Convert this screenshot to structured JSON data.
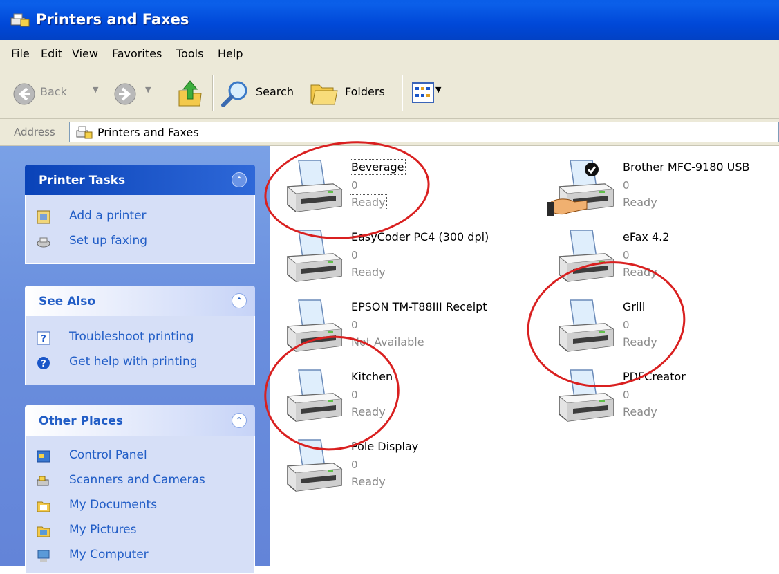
{
  "window": {
    "title": "Printers and Faxes"
  },
  "menu": {
    "items": [
      "File",
      "Edit",
      "View",
      "Favorites",
      "Tools",
      "Help"
    ]
  },
  "toolbar": {
    "back": "Back",
    "search": "Search",
    "folders": "Folders"
  },
  "address": {
    "label": "Address",
    "value": "Printers and Faxes"
  },
  "sidebar": {
    "printer_tasks": {
      "title": "Printer Tasks",
      "items": [
        "Add a printer",
        "Set up faxing"
      ]
    },
    "see_also": {
      "title": "See Also",
      "items": [
        "Troubleshoot printing",
        "Get help with printing"
      ]
    },
    "other_places": {
      "title": "Other Places",
      "items": [
        "Control Panel",
        "Scanners and Cameras",
        "My Documents",
        "My Pictures",
        "My Computer"
      ]
    }
  },
  "printers": [
    {
      "name": "Beverage",
      "count": "0",
      "status": "Ready"
    },
    {
      "name": "Brother MFC-9180 USB",
      "count": "0",
      "status": "Ready"
    },
    {
      "name": "EasyCoder PC4 (300 dpi)",
      "count": "0",
      "status": "Ready"
    },
    {
      "name": "eFax 4.2",
      "count": "0",
      "status": "Ready"
    },
    {
      "name": "EPSON TM-T88III Receipt",
      "count": "0",
      "status": "Not Available"
    },
    {
      "name": "Grill",
      "count": "0",
      "status": "Ready"
    },
    {
      "name": "Kitchen",
      "count": "0",
      "status": "Ready"
    },
    {
      "name": "PDFCreator",
      "count": "0",
      "status": "Ready"
    },
    {
      "name": "Pole Display",
      "count": "0",
      "status": "Ready"
    }
  ],
  "colors": {
    "titlebar": "#0048d8",
    "sidebar": "#6a8fde",
    "link": "#215dc6",
    "annotation": "#d92020"
  }
}
